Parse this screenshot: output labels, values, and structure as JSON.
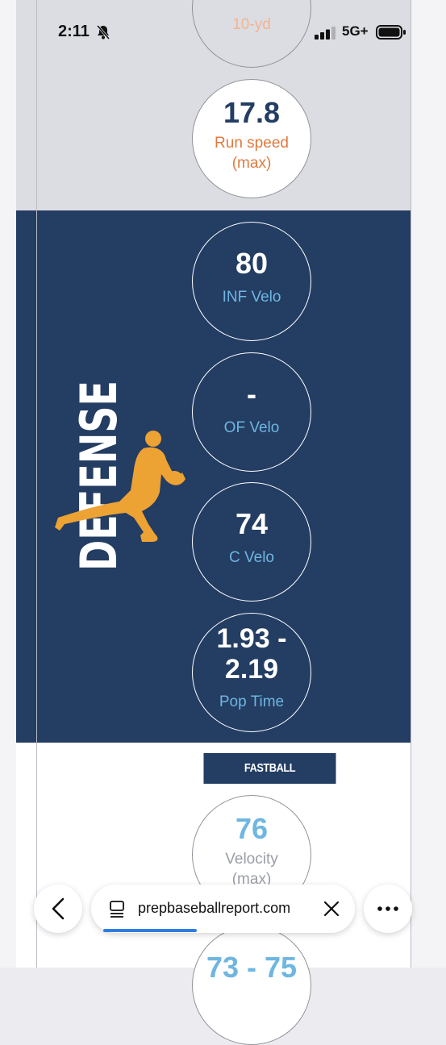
{
  "status_bar": {
    "time": "2:11",
    "network": "5G+"
  },
  "upper": {
    "partial_stat_label": "10-yd",
    "run_speed": {
      "value": "17.8",
      "label_line1": "Run speed",
      "label_line2": "(max)"
    }
  },
  "defense": {
    "section_title": "DEFENSE",
    "stats": [
      {
        "value": "80",
        "label": "INF Velo"
      },
      {
        "value": "-",
        "label": "OF Velo"
      },
      {
        "value": "74",
        "label": "C Velo"
      },
      {
        "value_line1": "1.93 -",
        "value_line2": "2.19",
        "label": "Pop Time"
      }
    ]
  },
  "pitching": {
    "fastball_header": "FASTBALL",
    "velocity": {
      "value": "76",
      "label_line1": "Velocity",
      "label_line2": "(max)"
    },
    "partial_range": "73 - 75"
  },
  "browser": {
    "url": "prepbaseballreport.com"
  },
  "colors": {
    "navy": "#233d63",
    "orange": "#e07a3f",
    "light_blue": "#6fb6e0",
    "player_gold": "#eda234"
  }
}
